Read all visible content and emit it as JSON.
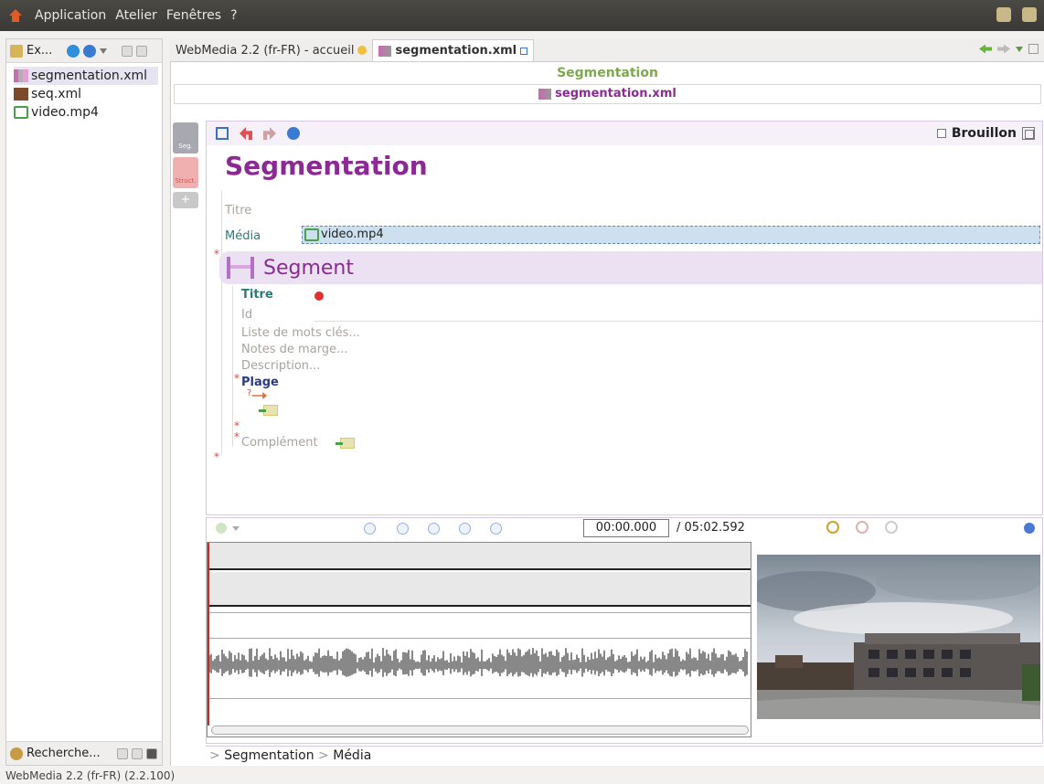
{
  "menubar": {
    "items": [
      "Application",
      "Atelier",
      "Fenêtres",
      "?"
    ]
  },
  "left_panel": {
    "header_label": "Ex...",
    "files": [
      "segmentation.xml",
      "seq.xml",
      "video.mp4"
    ],
    "bottom_label": "Recherche..."
  },
  "tabs": {
    "tab1": "WebMedia 2.2 (fr-FR) - accueil",
    "tab2": "segmentation.xml"
  },
  "document": {
    "title": "Segmentation",
    "file": "segmentation.xml"
  },
  "side_tabs": {
    "seg": "Seg.",
    "struct": "Struct.",
    "add": "+"
  },
  "editor": {
    "brouillon": "Brouillon",
    "heading": "Segmentation",
    "titre_label": "Titre",
    "media_label": "Média",
    "media_value": "video.mp4",
    "segment_label": "Segment",
    "seg_titre": "Titre",
    "seg_id": "Id",
    "mots_cles": "Liste de mots clés",
    "notes": "Notes de marge",
    "description": "Description",
    "plage": "Plage",
    "complement": "Complément",
    "ellipsis": "...",
    "star": "*",
    "qmark": "?"
  },
  "player": {
    "current_time": "00:00.000",
    "total_time": "/ 05:02.592"
  },
  "breadcrumb": {
    "sep": ">",
    "item1": "Segmentation",
    "item2": "Média"
  },
  "status": "WebMedia 2.2 (fr-FR) (2.2.100)",
  "colors": {
    "accent": "#8a2a92",
    "green_title": "#7da94c",
    "teal": "#2a7a7a"
  }
}
